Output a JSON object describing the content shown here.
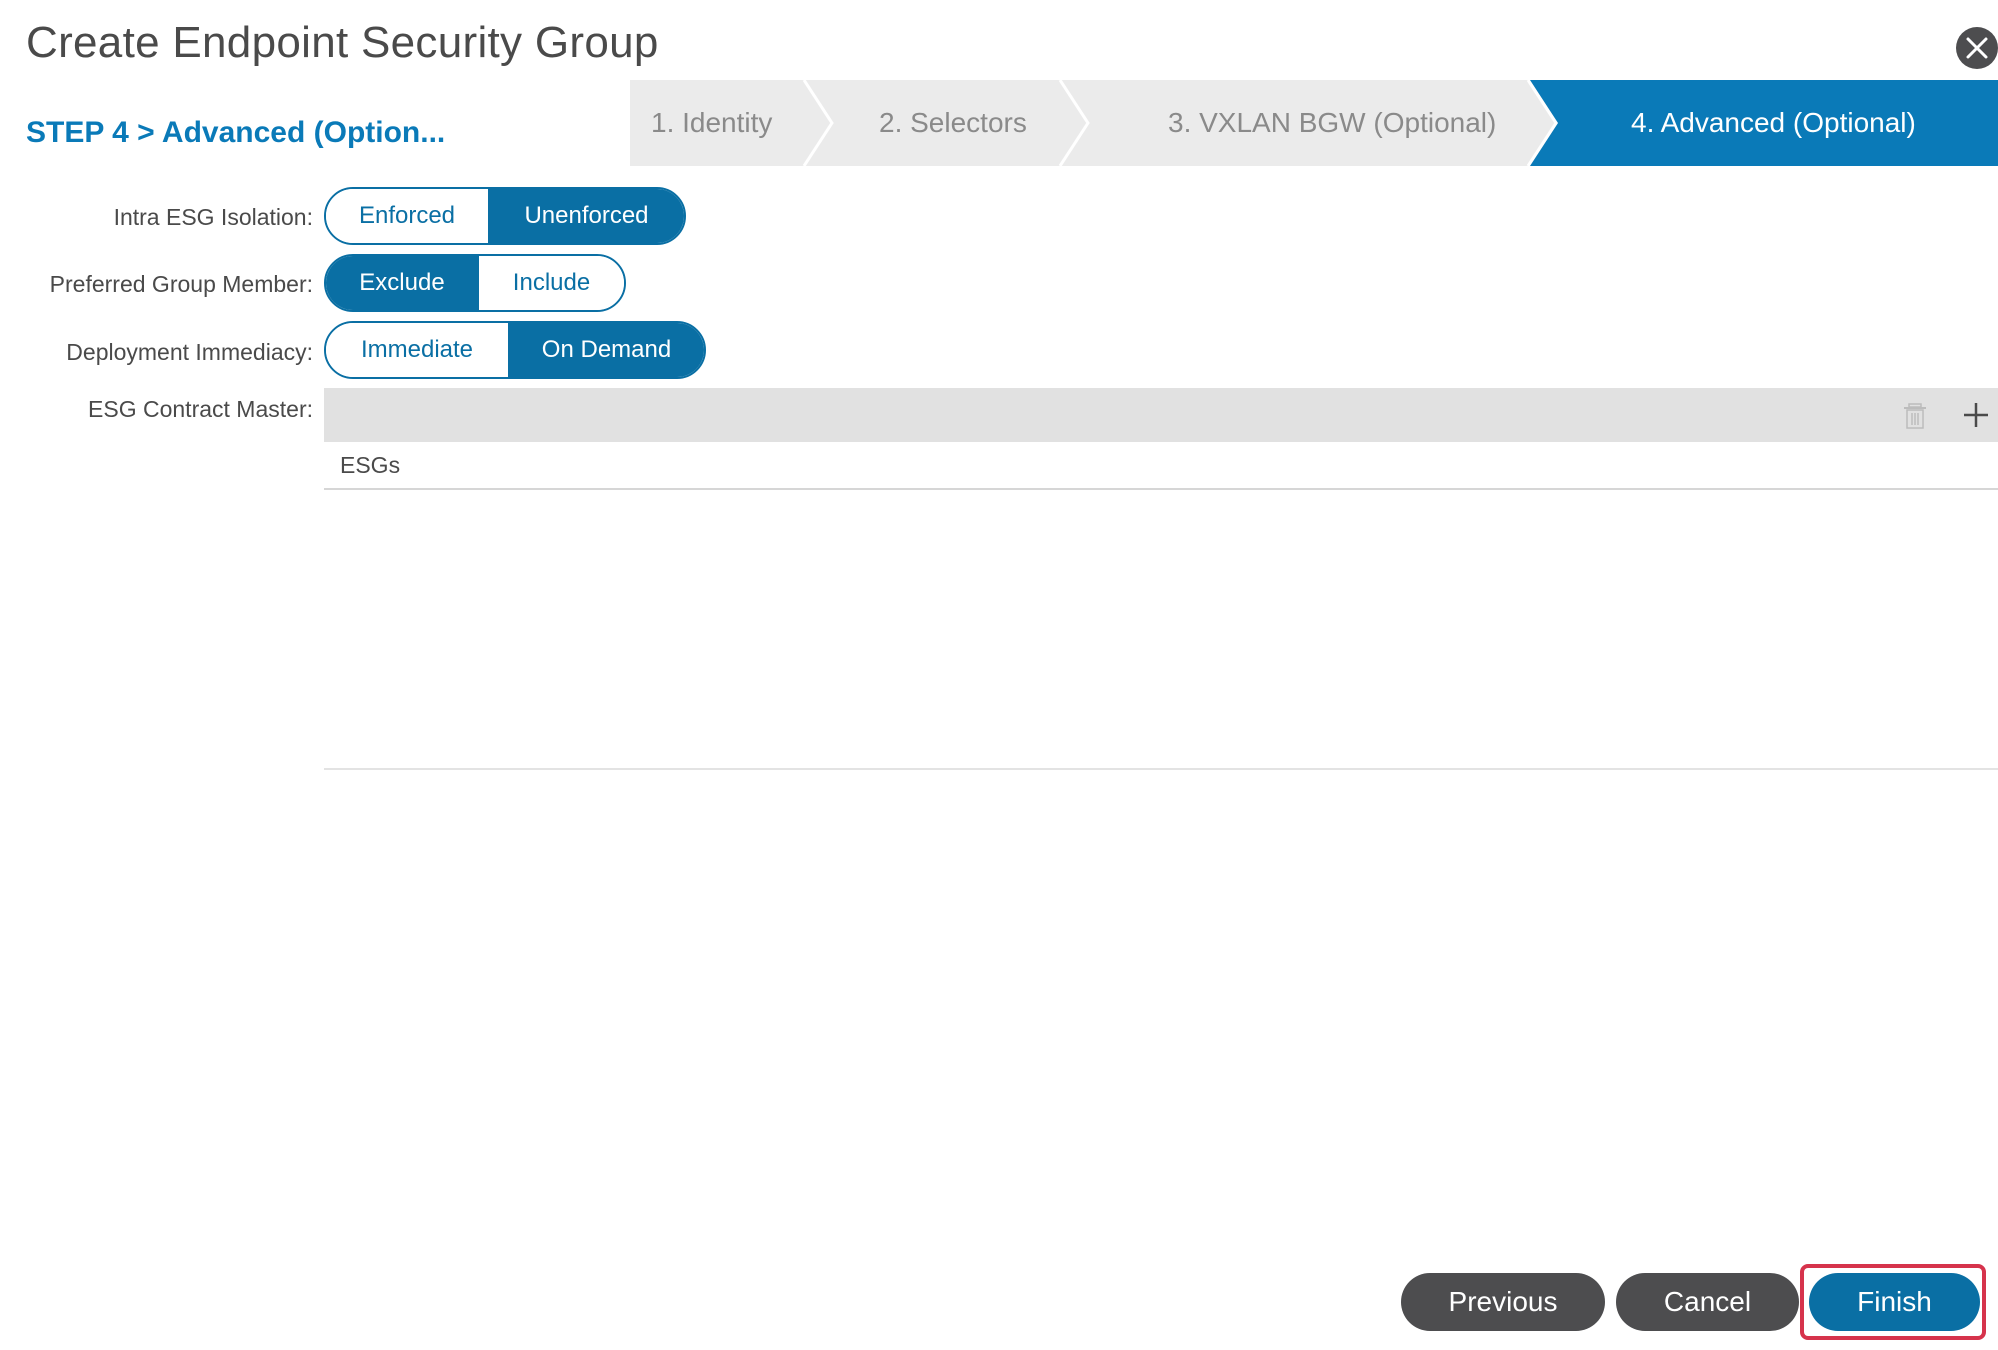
{
  "dialog": {
    "title": "Create Endpoint Security Group",
    "step_label": "STEP 4 > Advanced (Option..."
  },
  "wizard": {
    "steps": [
      {
        "label": "1. Identity",
        "active": false
      },
      {
        "label": "2. Selectors",
        "active": false
      },
      {
        "label": "3. VXLAN BGW (Optional)",
        "active": false
      },
      {
        "label": "4. Advanced (Optional)",
        "active": true
      }
    ]
  },
  "form": {
    "intra_esg_isolation": {
      "label": "Intra ESG Isolation:",
      "options": [
        "Enforced",
        "Unenforced"
      ],
      "selected": "Unenforced"
    },
    "preferred_group_member": {
      "label": "Preferred Group Member:",
      "options": [
        "Exclude",
        "Include"
      ],
      "selected": "Exclude"
    },
    "deployment_immediacy": {
      "label": "Deployment Immediacy:",
      "options": [
        "Immediate",
        "On Demand"
      ],
      "selected": "On Demand"
    },
    "esg_contract_master": {
      "label": "ESG Contract Master:",
      "column": "ESGs",
      "rows": []
    }
  },
  "footer": {
    "previous": "Previous",
    "cancel": "Cancel",
    "finish": "Finish"
  },
  "icons": {
    "close": "close-icon",
    "delete": "trash-icon",
    "add": "plus-icon"
  },
  "colors": {
    "accent": "#0a6fa4",
    "dark_button": "#4d4d4f",
    "highlight": "#d6334c"
  }
}
